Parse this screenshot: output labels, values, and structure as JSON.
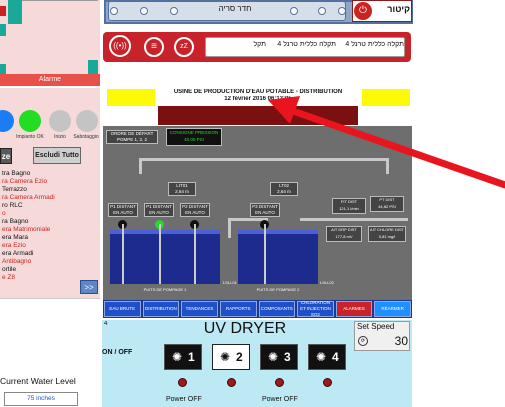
{
  "left_panel": {
    "alarm_label": "Alarme",
    "status": [
      {
        "label": "",
        "color": "#1a7df5"
      },
      {
        "label": "Impianto OK",
        "color": "#22dd22"
      },
      {
        "label": "Inizio",
        "color": "#c4c4c4"
      },
      {
        "label": "Sabotaggio",
        "color": "#c4c4c4"
      }
    ],
    "button_left": "ze",
    "button_escludi": "Escludi Tutto",
    "rooms": [
      {
        "label": "tra Bagno",
        "color": "#111111"
      },
      {
        "label": "ra Camera Ezio",
        "color": "#cc2222"
      },
      {
        "label": "Terrazzo",
        "color": "#111111"
      },
      {
        "label": "ra Camera Armadi",
        "color": "#cc2222"
      },
      {
        "label": "ro RLC",
        "color": "#111111"
      },
      {
        "label": "o",
        "color": "#cc2222"
      },
      {
        "label": "ra Bagno",
        "color": "#111111"
      },
      {
        "label": "era Matrimoniale",
        "color": "#cc2222"
      },
      {
        "label": "era Mara",
        "color": "#111111"
      },
      {
        "label": "era Ezio",
        "color": "#cc2222"
      },
      {
        "label": "era Armadi",
        "color": "#111111"
      },
      {
        "label": "Antibagno",
        "color": "#cc2222"
      },
      {
        "label": "ortile",
        "color": "#111111"
      },
      {
        "label": "e Z8",
        "color": "#cc2222"
      }
    ],
    "nav_next": ">>",
    "current_water_label": "Current Water Level",
    "water_value": "75 inches"
  },
  "top_header": {
    "room_name": "חדר סריה",
    "brand": "קיטור"
  },
  "red_bar": {
    "schedule_1": "תקלה כללית טרנל 4",
    "schedule_2": "תקלה כללית טרנל 4",
    "schedule_3": "תקל"
  },
  "scada": {
    "title": "USINE DE PRODUCTION D'EAU POTABLE - DISTRIBUTION",
    "date": "12 février 2016 06:12:05",
    "order_button": "ORDRE DE DÉPART POMPE 1, 2, 2",
    "consigne": "CONSIGNE PRESSION",
    "consigne_value": "40,00 PSI",
    "lit01": "LIT01",
    "lit01_value": "2,64 m",
    "lt02": "LT02",
    "lt02_value": "2,64 m",
    "pumps": [
      "P1 DISTANT EN AUTO",
      "P1 DISTANT EN AUTO",
      "P2 DISTANT EN AUTO",
      "P3 DISTANT EN AUTO"
    ],
    "sensors": [
      {
        "label": "FIT DIST",
        "value": "121,1 l/min"
      },
      {
        "label": "PT DIST",
        "value": "44,82 PSI"
      },
      {
        "label": "AIT DRP DIST",
        "value": "177,8 mV"
      },
      {
        "label": "AIT CHLORE DIST",
        "value": "0,81 mg/l"
      }
    ],
    "well_1": "PUITS DE POMPAGE 1",
    "well_2": "PUITS DE POMPAGE 2",
    "lsl_1": "LSLL01",
    "lsl_2": "LSLL02",
    "nav": [
      {
        "label": "EAU BRUTE",
        "color": "#2050c8"
      },
      {
        "label": "DISTRIBUTION",
        "color": "#2050c8"
      },
      {
        "label": "TENDANCES",
        "color": "#2050c8"
      },
      {
        "label": "RAPPORTS",
        "color": "#2050c8"
      },
      {
        "label": "COMPOSANTS",
        "color": "#2050c8"
      },
      {
        "label": "CHLORATION ET INJECTION SO2",
        "color": "#2050c8"
      },
      {
        "label": "ALARMES",
        "color": "#c8232a"
      },
      {
        "label": "RÉARMER",
        "color": "#1e90ff"
      }
    ]
  },
  "uv": {
    "panel_number": "4",
    "title": "UV DRYER",
    "on_off": "ON / OFF",
    "set_speed_label": "Set Speed",
    "set_speed_value": "30",
    "lamps": [
      "1",
      "2",
      "3",
      "4"
    ],
    "power_off_1": "Power OFF",
    "power_off_2": "Power OFF"
  },
  "colors": {
    "annotation_arrow": "#e8141e",
    "accent_red": "#c8232a"
  }
}
